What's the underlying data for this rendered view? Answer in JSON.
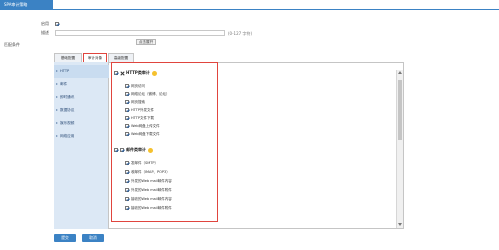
{
  "window": {
    "title_tab": "SPA审计策略"
  },
  "form": {
    "enable_label": "启用",
    "enable_checked": true,
    "desc_label": "描述",
    "desc_value": "",
    "desc_hint": "(0-127 字符)",
    "expand_button": "点击展开",
    "apply_object_label": "匹配条件"
  },
  "tabs": [
    {
      "label": "基础配置",
      "active": false
    },
    {
      "label": "审计对象",
      "active": true
    },
    {
      "label": "高级配置",
      "active": false
    }
  ],
  "left_nav": [
    {
      "label": "HTTP",
      "active": true
    },
    {
      "label": "邮件",
      "active": false
    },
    {
      "label": "即时通讯",
      "active": false
    },
    {
      "label": "数据协议",
      "active": false
    },
    {
      "label": "娱乐视频",
      "active": false
    },
    {
      "label": "网络应用",
      "active": false
    }
  ],
  "sections": [
    {
      "title": "HTTP类审计",
      "checked": true,
      "items": [
        {
          "label": "网页访问",
          "checked": true
        },
        {
          "label": "网络论坛（微博、论坛）",
          "checked": true
        },
        {
          "label": "网页搜索",
          "checked": true
        },
        {
          "label": "HTTP外发文件",
          "checked": true
        },
        {
          "label": "HTTP文件下载",
          "checked": true
        },
        {
          "label": "Web网盘上传文件",
          "checked": true
        },
        {
          "label": "Web网盘下载文件",
          "checked": true
        }
      ]
    },
    {
      "title": "邮件类审计",
      "checked": true,
      "items": [
        {
          "label": "发邮件（SMTP）",
          "checked": true
        },
        {
          "label": "收邮件（IMAP、POP3）",
          "checked": true
        },
        {
          "label": "外发的Web mail邮件内容",
          "checked": true
        },
        {
          "label": "外发的Web mail邮件附件",
          "checked": true
        },
        {
          "label": "接收的Web mail邮件内容",
          "checked": true
        },
        {
          "label": "接收的Web mail邮件附件",
          "checked": true
        }
      ]
    }
  ],
  "footer": {
    "ok_label": "提交",
    "cancel_label": "取消"
  }
}
